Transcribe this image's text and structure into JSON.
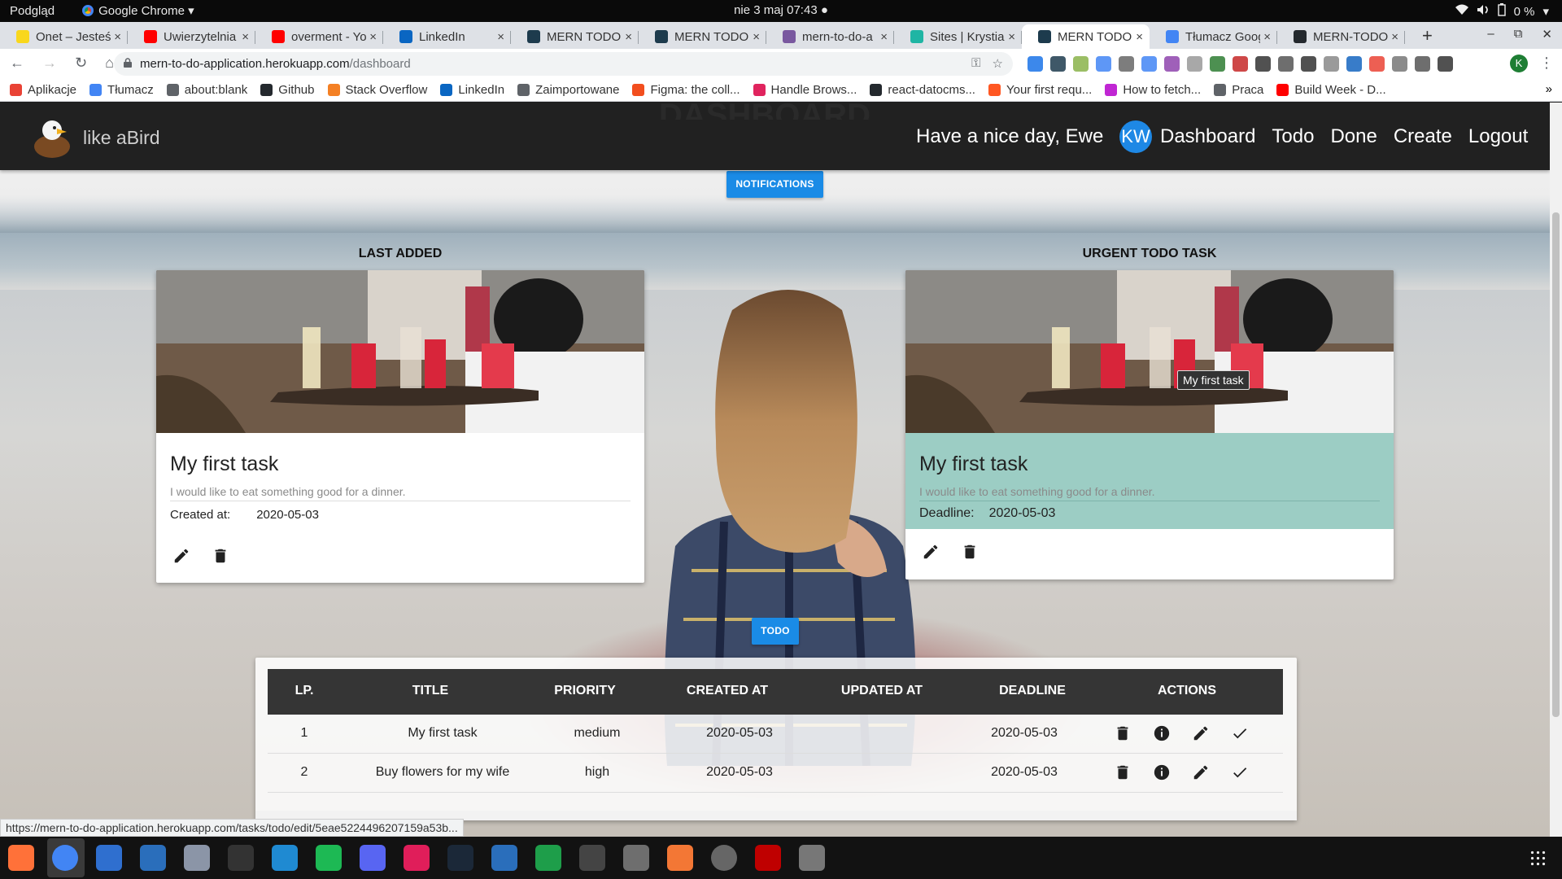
{
  "os_bar": {
    "activities": "Podgląd",
    "app_name": "Google Chrome ▾",
    "clock": "nie 3 maj  07:43 ●",
    "battery": "0 %"
  },
  "tabs": [
    {
      "label": "Onet – Jesteś",
      "color": "#f9d71c"
    },
    {
      "label": "Uwierzytelnia",
      "color": "#ff0000"
    },
    {
      "label": "overment - Yo",
      "color": "#ff0000"
    },
    {
      "label": "LinkedIn",
      "color": "#0a66c2"
    },
    {
      "label": "MERN TODO",
      "color": "#1d3b4d"
    },
    {
      "label": "MERN TODO",
      "color": "#1d3b4d"
    },
    {
      "label": "mern-to-do-a",
      "color": "#79589f"
    },
    {
      "label": "Sites | Krystia",
      "color": "#1fb5a4"
    },
    {
      "label": "MERN TODO",
      "color": "#1d3b4d",
      "active": true
    },
    {
      "label": "Tłumacz Goog",
      "color": "#4285f4"
    },
    {
      "label": "MERN-TODO",
      "color": "#24292e"
    }
  ],
  "tab_close": "×",
  "new_tab": "+",
  "window_controls": [
    "–",
    "⧉",
    "✕"
  ],
  "address": {
    "host": "mern-to-do-application.herokuapp.com",
    "path": "/dashboard"
  },
  "profile_initial": "K",
  "bookmarks": [
    {
      "label": "Aplikacje",
      "color": "#e94235"
    },
    {
      "label": "Tłumacz",
      "color": "#4285f4"
    },
    {
      "label": "about:blank",
      "color": "#5f6368"
    },
    {
      "label": "Github",
      "color": "#24292e"
    },
    {
      "label": "Stack Overflow",
      "color": "#f48024"
    },
    {
      "label": "LinkedIn",
      "color": "#0a66c2"
    },
    {
      "label": "Zaimportowane",
      "color": "#5f6368"
    },
    {
      "label": "Figma: the coll...",
      "color": "#f24e1e"
    },
    {
      "label": "Handle Brows...",
      "color": "#e0245e"
    },
    {
      "label": "react-datocms...",
      "color": "#24292e"
    },
    {
      "label": "Your first requ...",
      "color": "#ff5722"
    },
    {
      "label": "How to fetch...",
      "color": "#c026d3"
    },
    {
      "label": "Praca",
      "color": "#5f6368"
    },
    {
      "label": "Build Week - D...",
      "color": "#ff0000"
    }
  ],
  "bookmarks_more": "»",
  "app": {
    "brand": "like aBird",
    "hidden_heading": "DASHBOARD",
    "greeting": "Have a nice day, Ewe",
    "avatar_initials": "KW",
    "nav_links": [
      "Dashboard",
      "Todo",
      "Done",
      "Create",
      "Logout"
    ],
    "notifications_button": "NOTIFICATIONS",
    "todo_button": "TODO"
  },
  "last_added": {
    "section_title": "LAST ADDED",
    "title": "My first task",
    "description": "I would like to eat something good for a dinner.",
    "meta_label": "Created at:",
    "meta_value": "2020-05-03"
  },
  "urgent": {
    "section_title": "URGENT TODO TASK",
    "tooltip": "My first task",
    "title": "My first task",
    "description": "I would like to eat something good for a dinner.",
    "meta_label": "Deadline:",
    "meta_value": "2020-05-03",
    "highlight_color": "#9ccdc4"
  },
  "table": {
    "headers": [
      "LP.",
      "TITLE",
      "PRIORITY",
      "CREATED AT",
      "UPDATED AT",
      "DEADLINE",
      "ACTIONS"
    ],
    "rows": [
      {
        "lp": "1",
        "title": "My first task",
        "priority": "medium",
        "created": "2020-05-03",
        "updated": "",
        "deadline": "2020-05-03"
      },
      {
        "lp": "2",
        "title": "Buy flowers for my wife",
        "priority": "high",
        "created": "2020-05-03",
        "updated": "",
        "deadline": "2020-05-03"
      }
    ]
  },
  "status_url": "https://mern-to-do-application.herokuapp.com/tasks/todo/edit/5eae5224496207159a53b...",
  "dock_apps": [
    {
      "name": "firefox",
      "color": "#ff7139"
    },
    {
      "name": "chrome",
      "color": "#4285f4"
    },
    {
      "name": "thunderbird",
      "color": "#2f6fcf"
    },
    {
      "name": "writer",
      "color": "#2a6ebb"
    },
    {
      "name": "software",
      "color": "#8b95a7"
    },
    {
      "name": "terminal",
      "color": "#333333"
    },
    {
      "name": "vscode",
      "color": "#1f8ad2"
    },
    {
      "name": "spotify",
      "color": "#1db954"
    },
    {
      "name": "discord",
      "color": "#5865f2"
    },
    {
      "name": "slack",
      "color": "#e01e5a"
    },
    {
      "name": "steam",
      "color": "#1b2838"
    },
    {
      "name": "docs",
      "color": "#2a6ebb"
    },
    {
      "name": "calc",
      "color": "#1e9e4a"
    },
    {
      "name": "inkscape",
      "color": "#444444"
    },
    {
      "name": "gimp",
      "color": "#6e6e6e"
    },
    {
      "name": "appcenter",
      "color": "#f37735"
    },
    {
      "name": "settings",
      "color": "#666666"
    },
    {
      "name": "filezilla",
      "color": "#bf0000"
    },
    {
      "name": "usb",
      "color": "#777777"
    }
  ]
}
